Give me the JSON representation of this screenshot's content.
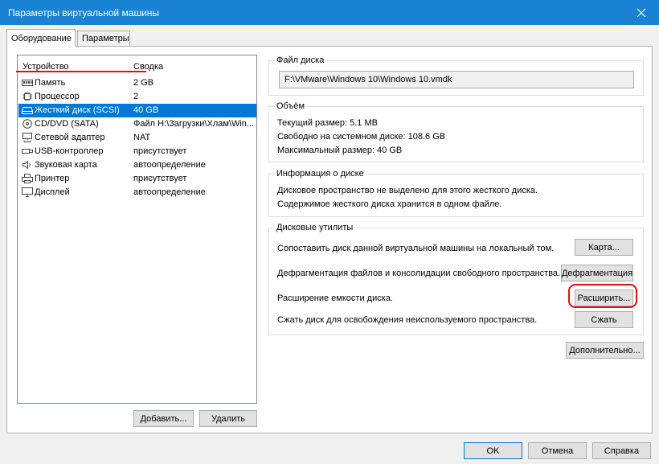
{
  "window": {
    "title": "Параметры виртуальной машины"
  },
  "tabs": [
    "Оборудование",
    "Параметры"
  ],
  "devices": {
    "header": {
      "device": "Устройство",
      "summary": "Сводка"
    },
    "items": [
      {
        "icon": "memory-icon",
        "name": "Память",
        "summary": "2 GB"
      },
      {
        "icon": "processor-icon",
        "name": "Процессор",
        "summary": "2"
      },
      {
        "icon": "hard-disk-icon",
        "name": "Жесткий диск (SCSI)",
        "summary": "40 GB",
        "selected": true
      },
      {
        "icon": "cd-dvd-icon",
        "name": "CD/DVD (SATA)",
        "summary": "Файл H:\\Загрузки\\Хлам\\Win..."
      },
      {
        "icon": "network-adapter-icon",
        "name": "Сетевой адаптер",
        "summary": "NAT"
      },
      {
        "icon": "usb-icon",
        "name": "USB-контроллер",
        "summary": "присутствует"
      },
      {
        "icon": "sound-card-icon",
        "name": "Звуковая карта",
        "summary": "автоопределение"
      },
      {
        "icon": "printer-icon",
        "name": "Принтер",
        "summary": "присутствует"
      },
      {
        "icon": "display-icon",
        "name": "Дисплей",
        "summary": "автоопределение"
      }
    ],
    "add_label": "Добавить...",
    "remove_label": "Удалить"
  },
  "disk_file": {
    "title": "Файл диска",
    "path": "F:\\VMware\\Windows 10\\Windows 10.vmdk"
  },
  "capacity": {
    "title": "Объём",
    "current": "Текущий размер: 5.1 MB",
    "free": "Свободно на системном диске: 108.6 GB",
    "max": "Максимальный размер: 40 GB"
  },
  "disk_info": {
    "title": "Информация о диске",
    "line1": "Дисковое пространство не выделено для этого жесткого диска.",
    "line2": "Содержимое жесткого диска хранится в одном файле."
  },
  "utilities": {
    "title": "Дисковые утилиты",
    "map_text": "Сопоставить диск данной виртуальной машины на локальный том.",
    "map_button": "Карта...",
    "defrag_text": "Дефрагментация файлов и консолидации свободного пространства.",
    "defrag_button": "Дефрагментация",
    "expand_text": "Расширение емкости диска.",
    "expand_button": "Расширить...",
    "compact_text": "Сжать диск для освобождения неиспользуемого пространства.",
    "compact_button": "Сжать"
  },
  "advanced_button": "Дополнительно...",
  "footer": {
    "ok": "OK",
    "cancel": "Отмена",
    "help": "Справка"
  },
  "colors": {
    "titlebar": "#1a82d2",
    "selection": "#0078d7",
    "highlight": "#e01010"
  }
}
